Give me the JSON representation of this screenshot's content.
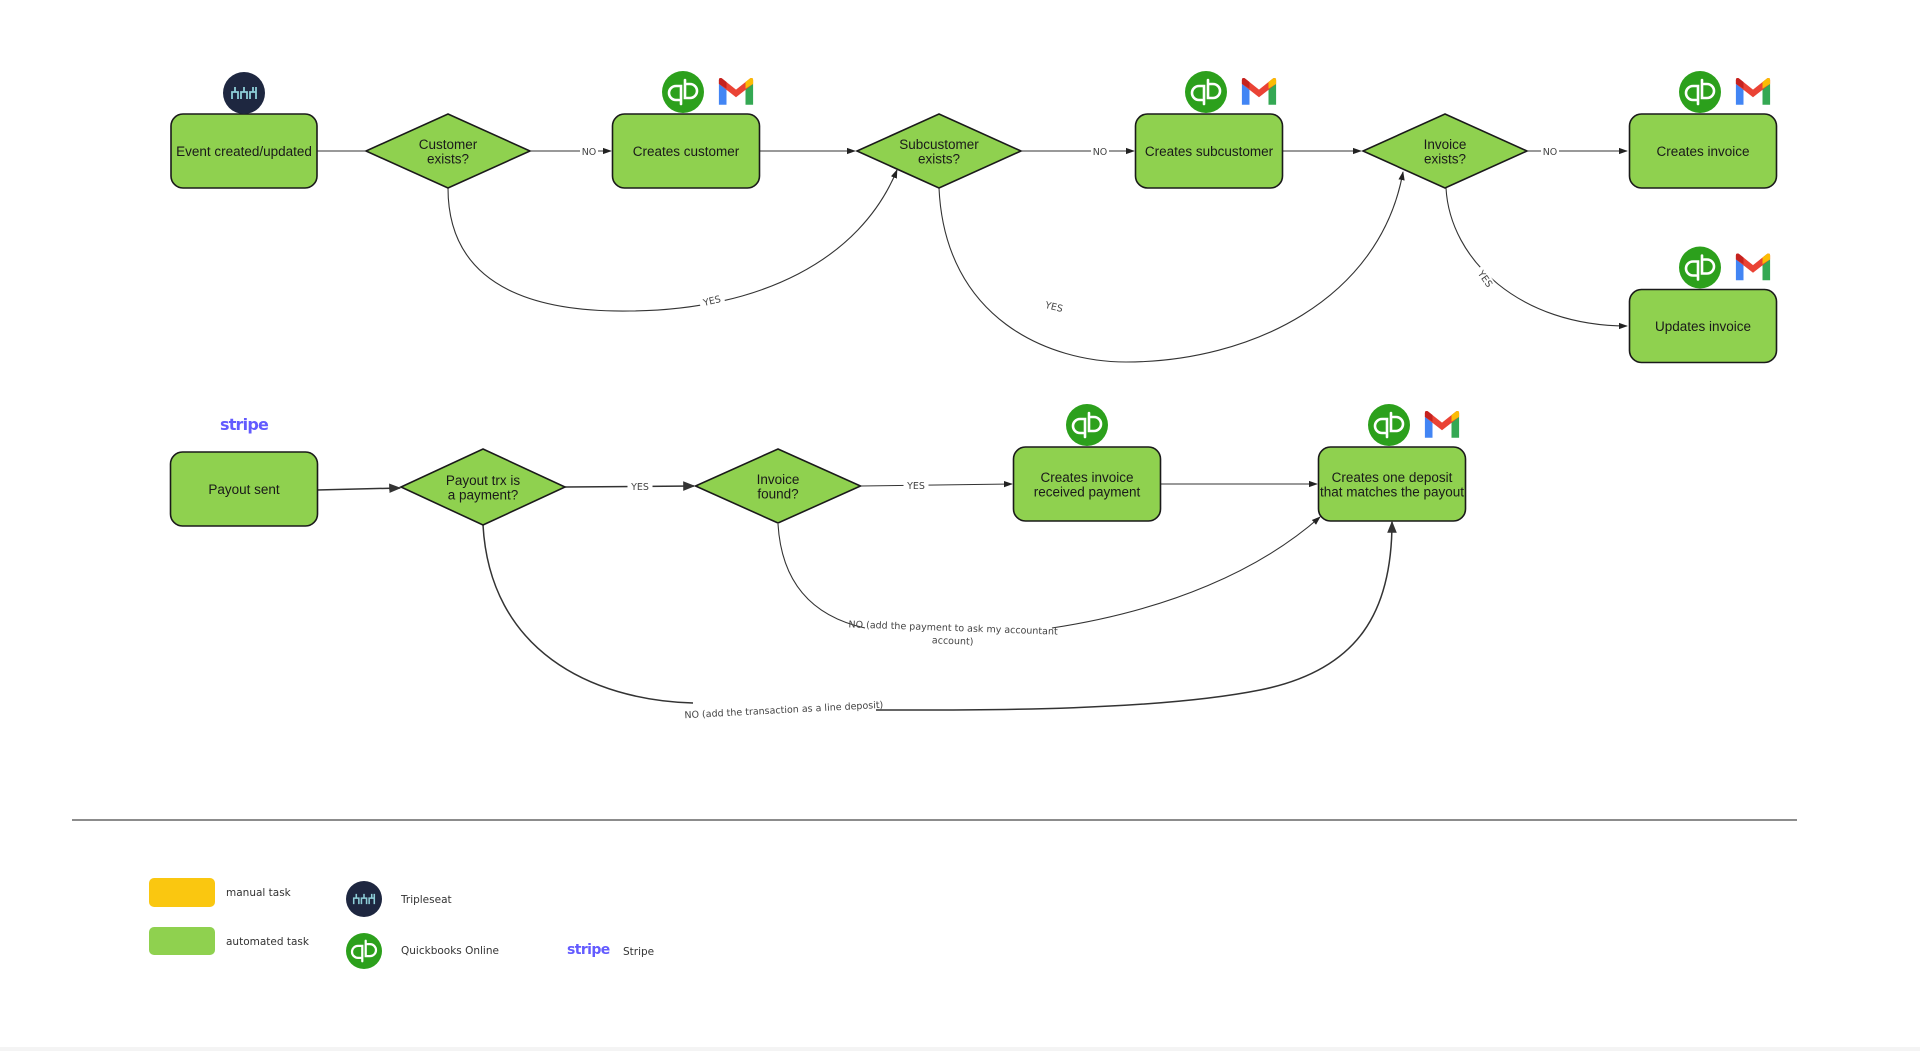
{
  "diagram": {
    "colors": {
      "automated": "#8fd14f",
      "manual": "#fac710",
      "stroke": "#1a1a1a",
      "edge": "#333333",
      "tripleseat_bg": "#1e2740",
      "tripleseat_fg": "#8ecfd8",
      "quickbooks": "#2ca01c",
      "stripe": "#635bff"
    },
    "flow1": {
      "nodes": [
        {
          "id": "event",
          "type": "process",
          "lines": [
            "Event created/updated"
          ],
          "icons": [
            "tripleseat"
          ]
        },
        {
          "id": "customer_exists",
          "type": "decision",
          "lines": [
            "Customer",
            "exists?"
          ],
          "icons": []
        },
        {
          "id": "creates_customer",
          "type": "process",
          "lines": [
            "Creates customer"
          ],
          "icons": [
            "quickbooks",
            "gmail"
          ]
        },
        {
          "id": "subcustomer_exists",
          "type": "decision",
          "lines": [
            "Subcustomer",
            "exists?"
          ],
          "icons": []
        },
        {
          "id": "creates_subcustomer",
          "type": "process",
          "lines": [
            "Creates subcustomer"
          ],
          "icons": [
            "quickbooks",
            "gmail"
          ]
        },
        {
          "id": "invoice_exists",
          "type": "decision",
          "lines": [
            "Invoice",
            "exists?"
          ],
          "icons": []
        },
        {
          "id": "creates_invoice",
          "type": "process",
          "lines": [
            "Creates invoice"
          ],
          "icons": [
            "quickbooks",
            "gmail"
          ]
        },
        {
          "id": "updates_invoice",
          "type": "process",
          "lines": [
            "Updates invoice"
          ],
          "icons": [
            "quickbooks",
            "gmail"
          ]
        }
      ],
      "edges": [
        {
          "from": "event",
          "to": "customer_exists",
          "label": ""
        },
        {
          "from": "customer_exists",
          "to": "creates_customer",
          "label": "NO"
        },
        {
          "from": "creates_customer",
          "to": "subcustomer_exists",
          "label": ""
        },
        {
          "from": "customer_exists",
          "to": "subcustomer_exists",
          "label": "YES"
        },
        {
          "from": "subcustomer_exists",
          "to": "creates_subcustomer",
          "label": "NO"
        },
        {
          "from": "creates_subcustomer",
          "to": "invoice_exists",
          "label": ""
        },
        {
          "from": "subcustomer_exists",
          "to": "invoice_exists",
          "label": "YES"
        },
        {
          "from": "invoice_exists",
          "to": "creates_invoice",
          "label": "NO"
        },
        {
          "from": "invoice_exists",
          "to": "updates_invoice",
          "label": "YES"
        }
      ]
    },
    "flow2": {
      "nodes": [
        {
          "id": "payout_sent",
          "type": "process",
          "lines": [
            "Payout sent"
          ],
          "icons": [
            "stripe"
          ]
        },
        {
          "id": "payout_is_payment",
          "type": "decision",
          "lines": [
            "Payout trx is",
            "a payment?"
          ],
          "icons": []
        },
        {
          "id": "invoice_found",
          "type": "decision",
          "lines": [
            "Invoice",
            "found?"
          ],
          "icons": []
        },
        {
          "id": "creates_received_payment",
          "type": "process",
          "lines": [
            "Creates invoice",
            "received payment"
          ],
          "icons": [
            "quickbooks"
          ]
        },
        {
          "id": "creates_deposit",
          "type": "process",
          "lines": [
            "Creates one deposit",
            "that matches the payout"
          ],
          "icons": [
            "quickbooks",
            "gmail"
          ]
        }
      ],
      "edges": [
        {
          "from": "payout_sent",
          "to": "payout_is_payment",
          "label": ""
        },
        {
          "from": "payout_is_payment",
          "to": "invoice_found",
          "label": "YES"
        },
        {
          "from": "invoice_found",
          "to": "creates_received_payment",
          "label": "YES"
        },
        {
          "from": "creates_received_payment",
          "to": "creates_deposit",
          "label": ""
        },
        {
          "from": "invoice_found",
          "to": "creates_deposit",
          "label": "NO (add the payment to ask my accountant account)",
          "label_lines": [
            "NO (add the payment to ask my accountant",
            "account)"
          ]
        },
        {
          "from": "payout_is_payment",
          "to": "creates_deposit",
          "label": "NO (add the transaction as a line deposit)",
          "label_lines": [
            "NO (add the transaction as a line deposit)"
          ]
        }
      ]
    },
    "icons": {
      "stripe_wordmark": "stripe"
    },
    "legend": {
      "task_types": [
        {
          "label": "manual task",
          "color_key": "manual"
        },
        {
          "label": "automated task",
          "color_key": "automated"
        }
      ],
      "apps": [
        {
          "label": "Tripleseat",
          "icon": "tripleseat"
        },
        {
          "label": "Quickbooks Online",
          "icon": "quickbooks"
        },
        {
          "label": "Stripe",
          "icon": "stripe"
        }
      ]
    }
  }
}
